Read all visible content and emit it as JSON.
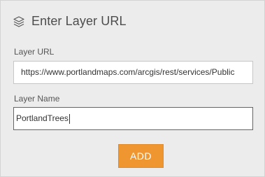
{
  "header": {
    "icon": "layers-icon",
    "title": "Enter Layer URL"
  },
  "form": {
    "url_label": "Layer URL",
    "url_value": "https://www.portlandmaps.com/arcgis/rest/services/Public",
    "name_label": "Layer Name",
    "name_value": "PortlandTrees"
  },
  "actions": {
    "add_label": "ADD"
  },
  "colors": {
    "accent_button": "#ef9631",
    "focus_border": "#2d73b4",
    "panel_bg": "#ececec"
  }
}
